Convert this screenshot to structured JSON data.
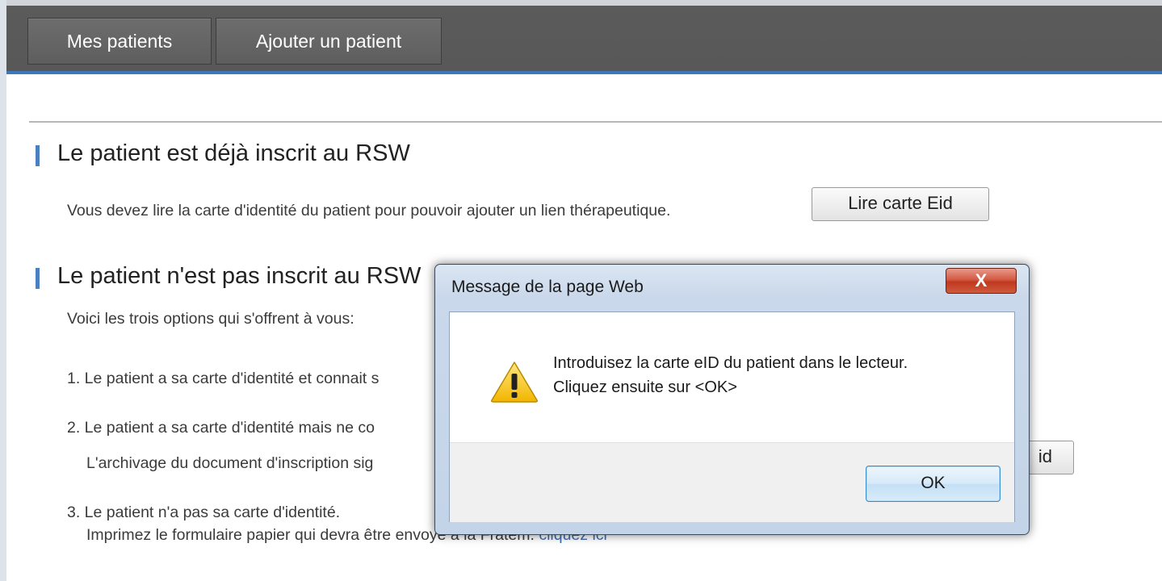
{
  "nav": {
    "tab1": "Mes patients",
    "tab2": "Ajouter un patient"
  },
  "section1": {
    "title": "Le patient est déjà inscrit au RSW",
    "text": "Vous devez lire la carte d'identité du patient pour pouvoir ajouter un lien thérapeutique.",
    "button": "Lire carte Eid"
  },
  "section2": {
    "title": "Le patient n'est pas inscrit au RSW",
    "intro": "Voici les trois options qui s'offrent à vous:",
    "option1": "1. Le patient a sa carte d'identité et connait s",
    "option2": "2. Le patient a sa carte d'identité mais ne co",
    "option2_sub": "L'archivage du document d'inscription sig",
    "option2_button": "id",
    "option3": "3. Le patient n'a pas sa carte d'identité.",
    "option3_sub": "Imprimez le formulaire papier qui devra être envoyé à la Fratem.",
    "option3_link": "cliquez ici"
  },
  "dialog": {
    "title": "Message de la page Web",
    "close": "X",
    "line1": "Introduisez la carte eID du patient dans le lecteur.",
    "line2": "Cliquez ensuite sur <OK>",
    "ok": "OK",
    "icon": "warning-icon"
  },
  "colors": {
    "nav_bg": "#5b5b5b",
    "accent": "#4a7fc0",
    "link": "#3f6fb4"
  }
}
